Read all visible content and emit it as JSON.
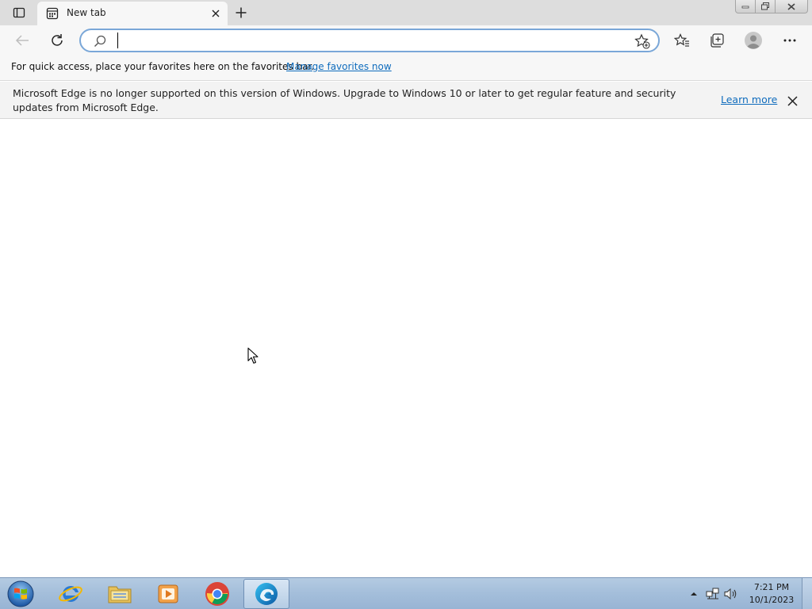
{
  "browser": {
    "tab": {
      "title": "New tab"
    },
    "address_bar": {
      "value": "",
      "placeholder": ""
    },
    "favorites_bar": {
      "message": "For quick access, place your favorites here on the favorites bar.",
      "link": "Manage favorites now"
    },
    "info_bar": {
      "message": "Microsoft Edge is no longer supported on this version of Windows. Upgrade to Windows 10 or later to get regular feature and security updates from Microsoft Edge.",
      "link": "Learn more"
    }
  },
  "taskbar": {
    "apps": [
      {
        "name": "internet-explorer",
        "active": false
      },
      {
        "name": "file-explorer",
        "active": false
      },
      {
        "name": "media-player",
        "active": false
      },
      {
        "name": "chrome",
        "active": false
      },
      {
        "name": "edge",
        "active": true
      }
    ],
    "clock": {
      "time": "7:21 PM",
      "date": "10/1/2023"
    }
  },
  "colors": {
    "accent": "#0f6cbd",
    "address_border": "#7aa7d8",
    "taskbar": "#a5bfdb"
  }
}
